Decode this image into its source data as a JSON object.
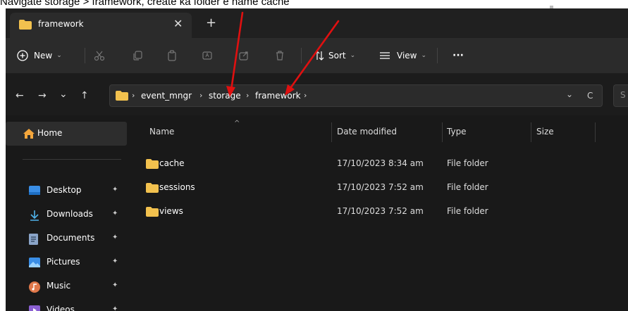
{
  "caption": "Navigate storage > framework, create ka folder e name cache",
  "tab": {
    "title": "framework",
    "close": "✕",
    "add": "+"
  },
  "toolbar": {
    "new_label": "New",
    "sort_label": "Sort",
    "view_label": "View",
    "more": "···",
    "chevron": "⌄"
  },
  "nav": {
    "back": "←",
    "forward": "→",
    "recent": "⌄",
    "up": "↑"
  },
  "address": {
    "crumbs": [
      "event_mngr",
      "storage",
      "framework"
    ],
    "separator": "›",
    "dropdown": "⌄",
    "refresh": "C",
    "search_hint": "S"
  },
  "sidebar": {
    "home": "Home",
    "items": [
      {
        "label": "Desktop",
        "icon": "desktop-icon"
      },
      {
        "label": "Downloads",
        "icon": "downloads-icon"
      },
      {
        "label": "Documents",
        "icon": "documents-icon"
      },
      {
        "label": "Pictures",
        "icon": "pictures-icon"
      },
      {
        "label": "Music",
        "icon": "music-icon"
      },
      {
        "label": "Videos",
        "icon": "videos-icon"
      }
    ],
    "pin": "📌"
  },
  "list": {
    "columns": [
      "Name",
      "Date modified",
      "Type",
      "Size"
    ],
    "rows": [
      {
        "name": "cache",
        "date": "17/10/2023 8:34 am",
        "type": "File folder"
      },
      {
        "name": "sessions",
        "date": "17/10/2023 7:52 am",
        "type": "File folder"
      },
      {
        "name": "views",
        "date": "17/10/2023 7:52 am",
        "type": "File folder"
      }
    ]
  },
  "colors": {
    "folder": "#f2c14e",
    "annotation": "#e01010",
    "background": "#191919"
  }
}
